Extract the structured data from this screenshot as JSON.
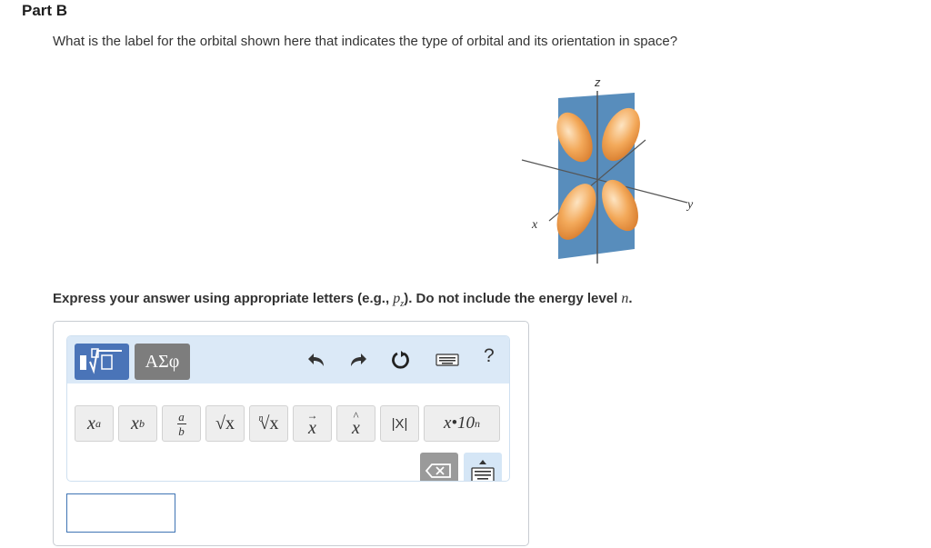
{
  "part": {
    "title": "Part B"
  },
  "question": {
    "text": "What is the label for the orbital shown here that indicates the type of orbital and its orientation in space?"
  },
  "figure": {
    "axis_z": "z",
    "axis_y": "y",
    "axis_x": "x"
  },
  "instruction": {
    "prefix": "Express your answer using appropriate letters (e.g., ",
    "example_var": "p",
    "example_sub": "z",
    "middle": "). Do not include the energy level ",
    "level_var": "n",
    "suffix": "."
  },
  "toolbar": {
    "symbols_label": "ΑΣφ",
    "help_label": "?",
    "buttons": [
      {
        "id": "superscript",
        "base": "x",
        "mod": "a"
      },
      {
        "id": "subscript",
        "base": "x",
        "mod": "b"
      },
      {
        "id": "fraction",
        "num": "a",
        "den": "b"
      },
      {
        "id": "sqrt",
        "label": "√x"
      },
      {
        "id": "nthroot",
        "index": "n",
        "label": "√x"
      },
      {
        "id": "vector",
        "accent": "→",
        "label": "x"
      },
      {
        "id": "unit-vector",
        "accent": "^",
        "label": "x"
      },
      {
        "id": "abs",
        "label": "|X|"
      },
      {
        "id": "sci-notation",
        "label": "x•10",
        "exp": "n"
      }
    ]
  },
  "answer": {
    "value": ""
  },
  "colors": {
    "templates_button": "#4a74b8",
    "symbols_button": "#7d7d7d",
    "toolbar_bg": "#dbe9f7",
    "orbital": "#f0a85a",
    "plane": "#4f87b8"
  }
}
